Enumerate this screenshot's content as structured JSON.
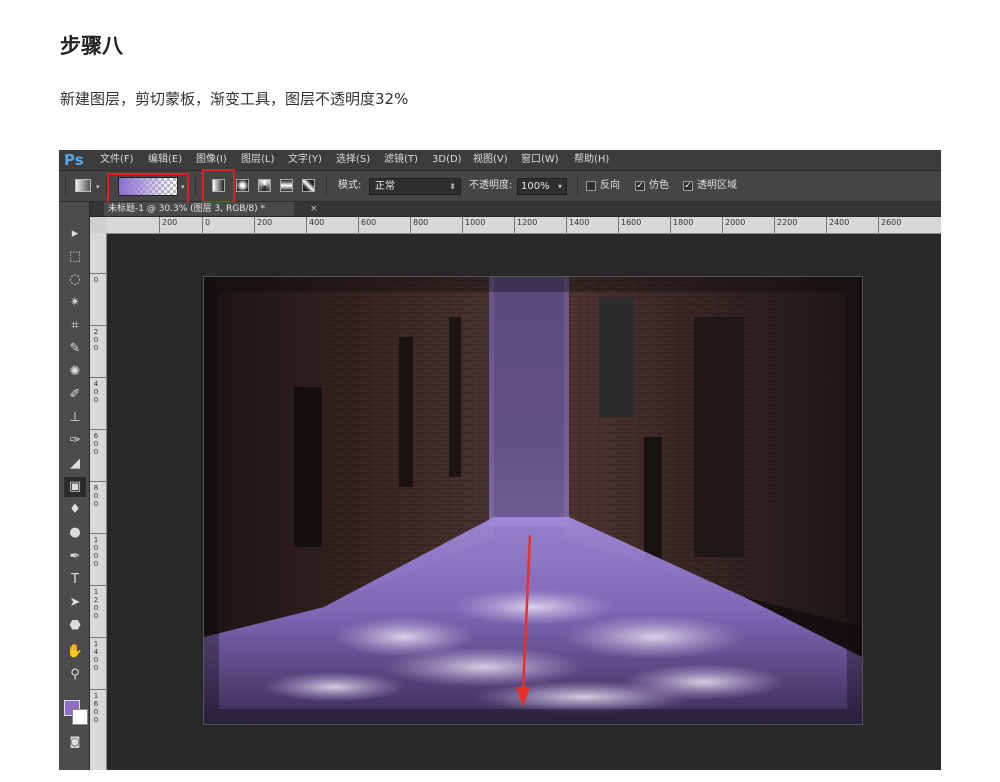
{
  "article": {
    "title": "步骤八",
    "text": "新建图层，剪切蒙板，渐变工具，图层不透明度32%"
  },
  "app": {
    "logo": "Ps",
    "menu": [
      "文件(F)",
      "编辑(E)",
      "图像(I)",
      "图层(L)",
      "文字(Y)",
      "选择(S)",
      "滤镜(T)",
      "3D(D)",
      "视图(V)",
      "窗口(W)",
      "帮助(H)"
    ]
  },
  "options": {
    "gradient_preview_colors": [
      "#8c70cd",
      "transparent"
    ],
    "mode_label": "模式:",
    "mode_value": "正常",
    "opacity_label": "不透明度:",
    "opacity_value": "100%",
    "reverse_label": "反向",
    "reverse_checked": false,
    "dither_label": "仿色",
    "dither_checked": true,
    "transparency_label": "透明区域",
    "transparency_checked": true,
    "highlight_color": "#e01e24"
  },
  "document": {
    "tab_title": "未标题-1 @ 30.3% (图层 3, RGB/8) *",
    "close_glyph": "×"
  },
  "ruler": {
    "h_labels": [
      "200",
      "0",
      "200",
      "400",
      "600",
      "800",
      "1000",
      "1200",
      "1400",
      "1600",
      "1800",
      "2000",
      "2200",
      "2400",
      "2600"
    ],
    "v_labels": [
      "0",
      "200",
      "400",
      "600",
      "800",
      "1000",
      "1200",
      "1400",
      "1600"
    ]
  },
  "tools": [
    "move-icon",
    "marquee-icon",
    "lasso-icon",
    "magic-wand-icon",
    "crop-icon",
    "eyedropper-icon",
    "healing-brush-icon",
    "brush-icon",
    "clone-stamp-icon",
    "history-brush-icon",
    "eraser-icon",
    "gradient-icon",
    "blur-icon",
    "dodge-icon",
    "pen-icon",
    "type-icon",
    "path-selection-icon",
    "shape-icon",
    "hand-icon",
    "zoom-icon"
  ],
  "colors": {
    "foreground": "#8e6fc4",
    "background": "#ffffff",
    "arrow": "#e8302b",
    "purple_glow": "#8a6fd0"
  }
}
